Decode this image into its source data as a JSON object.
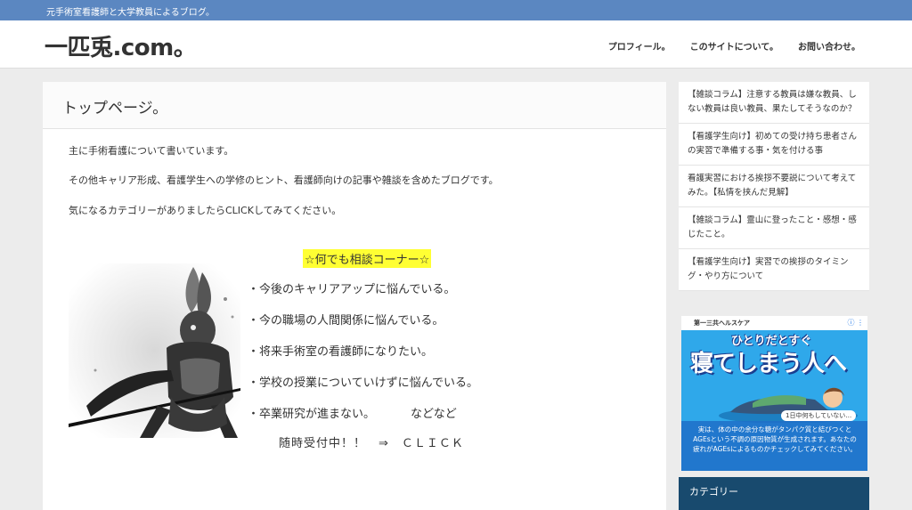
{
  "topbar": {
    "tagline": "元手術室看護師と大学教員によるブログ。"
  },
  "header": {
    "site_title": "一匹兎.com。",
    "nav": [
      {
        "label": "プロフィール。"
      },
      {
        "label": "このサイトについて。"
      },
      {
        "label": "お問い合わせ。"
      }
    ]
  },
  "main": {
    "page_title": "トップページ。",
    "paragraphs": [
      "主に手術看護について書いています。",
      "その他キャリア形成、看護学生への学修のヒント、看護師向けの記事や雑談を含めたブログです。",
      "気になるカテゴリーがありましたらCLICKしてみてください。"
    ],
    "consult_title": "☆何でも相談コーナー☆",
    "bullets": [
      "・今後のキャリアアップに悩んでいる。",
      "・今の職場の人間関係に悩んでいる。",
      "・将来手術室の看護師になりたい。",
      "・学校の授業についていけずに悩んでいる。",
      "・卒業研究が進まない。"
    ],
    "bullet_extra": "などなど",
    "cta": "随時受付中！！　⇒　ＣＬＩＣＫ"
  },
  "sidebar": {
    "recent_posts": [
      "【雑談コラム】注意する教員は嫌な教員、しない教員は良い教員、果たしてそうなのか？",
      "【看護学生向け】初めての受け持ち患者さんの実習で準備する事・気を付ける事",
      "看護実習における挨拶不要説について考えてみた。【私情を挟んだ見解】",
      "【雑談コラム】霊山に登ったこと・感想・感じたこと。",
      "【看護学生向け】実習での挨拶のタイミング・やり方について"
    ],
    "ad": {
      "brand": "第一三共ヘルスケア",
      "headline_small": "ひとりだとすぐ",
      "headline_big": "寝てしまう人へ",
      "bubble": "1日中何もしていない…",
      "body": "実は、体の中の余分な糖がタンパク質と結びつくとAGEsという不調の原因物質が生成されます。あなたの疲れがAGEsによるものかチェックしてみてください。",
      "icons": "ⓘ ⋮"
    },
    "category_title": "カテゴリー"
  },
  "colors": {
    "topbar": "#5b87c1",
    "highlight": "#ffff33",
    "category_header": "#184a6e",
    "ad_blue": "#2fa8ea"
  }
}
